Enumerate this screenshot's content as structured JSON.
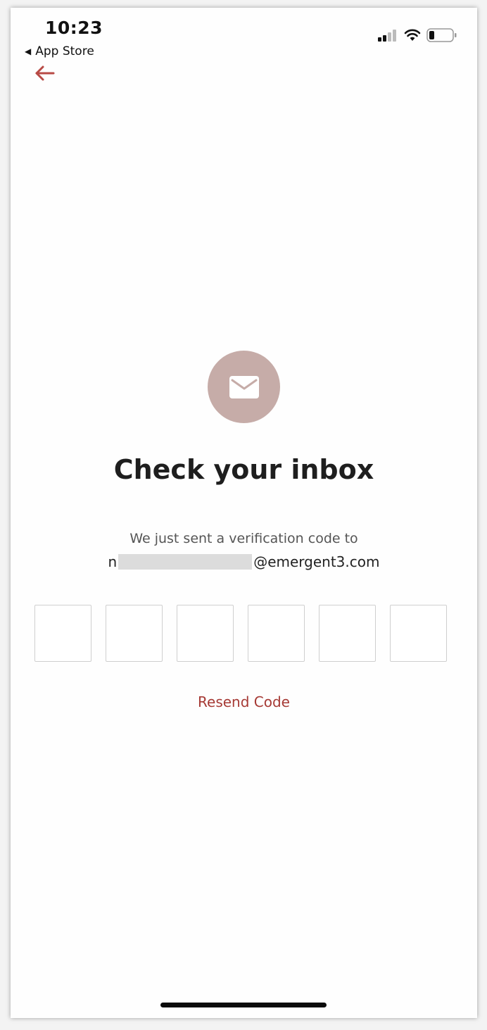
{
  "status_bar": {
    "time": "10:23",
    "back_app_label": "App Store",
    "back_app_icon": "back-triangle-icon",
    "signal_icon": "cellular-signal-icon",
    "wifi_icon": "wifi-icon",
    "battery_icon": "battery-icon"
  },
  "nav": {
    "back_icon": "arrow-left-icon",
    "accent_color": "#b84a45"
  },
  "content": {
    "icon": "mail-icon",
    "icon_bg_color": "#c6aca8",
    "title": "Check your inbox",
    "subtitle": "We just sent a verification code to",
    "email_prefix": "n",
    "email_suffix": "@emergent3.com",
    "code_digits": [
      "",
      "",
      "",
      "",
      "",
      ""
    ],
    "resend_label": "Resend Code",
    "resend_color": "#a63a35"
  }
}
